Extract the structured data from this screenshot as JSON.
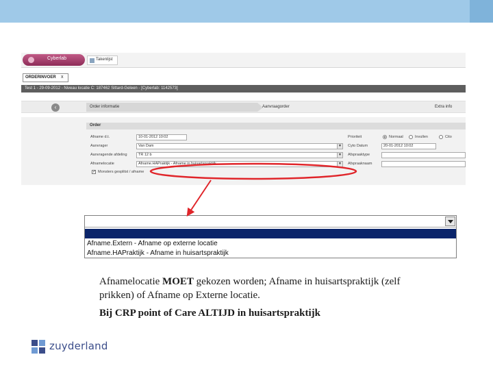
{
  "app": {
    "logo_text": "Cyberlab",
    "tasklist_label": "Takenlijst",
    "order_tab_label": "ORDERINVOER",
    "order_tab_close": "x",
    "patient_info": "Test 1 - 29-09-2012 - Niveau locatie C: 187462 Sittard-Geleen - [Cyberlab: 1142573]",
    "steps": [
      "Order informatie",
      "Aanvraagorder",
      "Extra info"
    ],
    "form_header": "Order",
    "fields_left": [
      {
        "label": "Afname d.t.",
        "value": "10-01-2012 10:02"
      },
      {
        "label": "Aanvrager",
        "value": "Van Dam"
      },
      {
        "label": "Aanvragende afdeling",
        "value": "TR 12 b"
      },
      {
        "label": "Afnamelocatie",
        "value": "Afname.HAPraktijk - Afname in huisartspraktijk"
      }
    ],
    "fields_right": [
      {
        "label": "Prioriteit",
        "value": ""
      },
      {
        "label": "Cyto Datum",
        "value": "20-01-2012 10:02"
      },
      {
        "label": "Afspraaktype",
        "value": ""
      },
      {
        "label": "Afspraaknaam",
        "value": ""
      }
    ],
    "priority_options": [
      "Normaal",
      "Invullen",
      "Cito"
    ],
    "checkbox_label": "Monsters gesplitst / afname"
  },
  "dropdown": {
    "selected": "",
    "options": [
      "Afname.Extern - Afname op externe locatie",
      "Afname.HAPraktijk - Afname in huisartspraktijk"
    ]
  },
  "caption": {
    "line1_pre": "Afnamelocatie ",
    "line1_bold": "MOET",
    "line1_post": " gekozen worden; Afname in huisartspraktijk (zelf prikken) of Afname op Externe locatie.",
    "line2": "Bij CRP point of Care ALTIJD in huisartspraktijk"
  },
  "brand": {
    "name": "zuyderland",
    "color": "#3b4d8a"
  },
  "colors": {
    "top_band": "#9fc9e8",
    "annotation": "#e0252a",
    "dropdown_highlight": "#0a246a"
  }
}
